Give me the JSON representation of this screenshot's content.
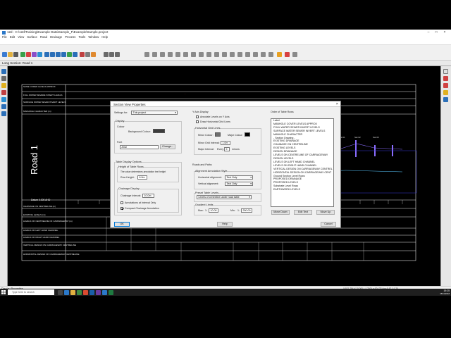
{
  "window": {
    "title": "12d - C:\\12d\\Training\\Example Data\\Sample_F\\Example\\Sample.project",
    "menu": [
      "File",
      "Edit",
      "View",
      "Surface",
      "Road",
      "Drainage",
      "Process",
      "Tools",
      "Window",
      "Help"
    ]
  },
  "doc_tab": "Long Section: Road 1",
  "section": {
    "road_label": "Road 1",
    "datum": "Datum 0.000 AHD",
    "bands": [
      "NAME CODED LEVELS APPROX",
      "FULL WATER SEVERE INVERT LEVELS",
      "SURFACE WATER SEVER INVERT LEVELS",
      "MANHOLE CHARACTER (m)",
      "CHAINAGE ON CENTRELINE (m)",
      "EXISTING LEVELS (m)",
      "LEVELS ON CENTRELINE OF CARRIAGEWAY (m)",
      "LEVELS ON LEFT HAND CHANNEL",
      "LEVELS ON RIGHT HAND CHANNEL",
      "VERTICAL DESIGN ON CARRIAGEWAY CENTRELINE",
      "HORIZONTAL DESIGN ON CARRIAGEWAY CENTRELINE"
    ]
  },
  "dialog": {
    "title": "Section View Properties",
    "close": "×",
    "settings_for_label": "Settings for:",
    "settings_for_value": "This project",
    "display": {
      "group": "Display",
      "colour": "Colour",
      "background_colour": "Background Colour:",
      "font": "Font",
      "font_value": "Arial",
      "change": "Change..."
    },
    "table_display": {
      "group": "Table Display Options",
      "height_group": "Height of Table Rows",
      "height_note": "The value determines annotation text height",
      "row_height_label": "Row Height:",
      "row_height_value": "6.0m"
    },
    "chainage_display": {
      "group": "Chainage Display",
      "interval_label": "Chainage Interval:",
      "interval_value": "10.0m",
      "annotate_label": "Annotations at Interval Only",
      "annotate_checked": false,
      "compact_label": "Compact Chainage Annotation",
      "compact_checked": true
    },
    "yaxis": {
      "group": "Y Axis Display",
      "annotate_levels": "Annotate Levels on Y Axis",
      "annotate_checked": false,
      "draw_gridlines": "Draw Horizontal Grid Lines",
      "draw_checked": false,
      "grid_group": "Horizontal Grid Lines",
      "minor_colour": "Minor Colour:",
      "major_colour": "Major Colour:",
      "minor_interval_label": "Minor Grid Interval:",
      "minor_interval_value": "1.0m",
      "major_interval_label": "Major Interval:",
      "major_every": "Every",
      "major_every_value": "5",
      "major_minor": "minors"
    },
    "roads": {
      "group": "Roads and Paths",
      "alignment_style": "Alignment Annotation Style",
      "horizontal_label": "Horizontal alignment:",
      "horizontal_value": "Text Only",
      "vertical_label": "Vertical alignment:",
      "vertical_value": "Text Only",
      "preset_group": "Preset Table Levels",
      "preset_value": "Levels of centreline under road table",
      "gradient_group": "Gradient Limits",
      "max_label": "Max:",
      "max_prefix": "1:",
      "max_value": "10.00",
      "min_label": "Min:",
      "min_prefix": "1:",
      "min_value": "250.00"
    },
    "order": {
      "group": "Order of Table Rows",
      "items": [
        "Label",
        "MANHOLE COVER LEVELS APPROX",
        "FOUL WATER SEWER INVERT LEVELS",
        "SURFACE WATER SEWER INVERT LEVELS",
        "MANHOLE CHARACTER",
        "- Section Drawing -",
        "EXISTING DRAINAGE",
        "CHAINAGE ON CENTRELINE",
        "EXISTING LEVELS",
        "DESIGN DRAINAGE",
        "LEVELS ON CENTRELINE OF CARRIAGEWAY",
        "DESIGN LEVELS",
        "LEVELS ON LEFT HAND CHANNEL",
        "LEVELS ON RIGHT HAND CHANNEL",
        "VERTICAL DESIGN ON CARRIAGEWAY CENTREL",
        "HORIZONTAL DESIGN ON CARRIAGEWAY CENT",
        "Ground Section Level Rows",
        "PROPOSED DRAINAGE",
        "PROPOSED LEVELS",
        "Substrate Level Rows",
        "EARTHWORK LEVELS"
      ],
      "move_down": "Move Down",
      "edit_text": "Edit Text",
      "move_up": "Move Up"
    },
    "ok": "OK",
    "help": "Help",
    "cancel": "Cancel"
  },
  "status": {
    "left": "Display Properties",
    "right": "X:521.784   Y:10.000   L:1.200   Ln:104.32   Ang:6.42   1:1.20"
  },
  "taskbar": {
    "search_placeholder": "Type here to search",
    "time": "19:25",
    "date": "15/11/2018"
  },
  "colors": {
    "background_swatch": "#3c3c3c",
    "minor_swatch": "#6e6e6e",
    "major_swatch": "#000000"
  }
}
